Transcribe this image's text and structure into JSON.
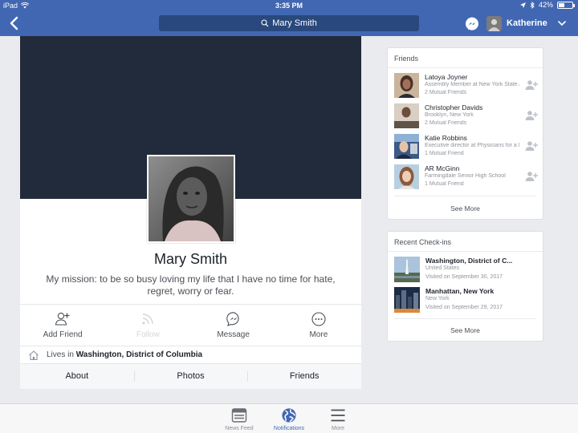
{
  "status_bar": {
    "device": "iPad",
    "time": "3:35 PM",
    "battery_label": "42%",
    "battery_level": 0.42
  },
  "navbar": {
    "search_text": "Mary Smith",
    "user_name": "Katherine"
  },
  "profile": {
    "name": "Mary Smith",
    "bio": "My mission: to be so busy loving my life that I have no time for hate, regret, worry or fear.",
    "actions": {
      "add_friend": "Add Friend",
      "follow": "Follow",
      "message": "Message",
      "more": "More"
    },
    "lives_prefix": "Lives in",
    "lives_place": "Washington, District of Columbia",
    "tabs": [
      "About",
      "Photos",
      "Friends"
    ]
  },
  "friends_card": {
    "title": "Friends",
    "see_more": "See More",
    "items": [
      {
        "name": "Latoya Joyner",
        "detail": "Assembly Member at New York State Assembly",
        "mutual": "2 Mutual Friends"
      },
      {
        "name": "Christopher Davids",
        "detail": "Brooklyn, New York",
        "mutual": "2 Mutual Friends"
      },
      {
        "name": "Katie Robbins",
        "detail": "Executive director at Physicians for a National Health Program",
        "mutual": "1 Mutual Friend"
      },
      {
        "name": "AR McGinn",
        "detail": "Farmingdale Senior High School",
        "mutual": "1 Mutual Friend"
      }
    ]
  },
  "checkins_card": {
    "title": "Recent Check-ins",
    "see_more": "See More",
    "items": [
      {
        "place": "Washington, District of C...",
        "region": "United States",
        "visited": "Visited on September 30, 2017"
      },
      {
        "place": "Manhattan, New York",
        "region": "New York",
        "visited": "Visited on September 29, 2017"
      }
    ]
  },
  "tabbar": {
    "news_feed": "News Feed",
    "notifications": "Notifications",
    "more": "More"
  },
  "colors": {
    "brand_blue": "#4267b2",
    "cover": "#222b3b"
  }
}
